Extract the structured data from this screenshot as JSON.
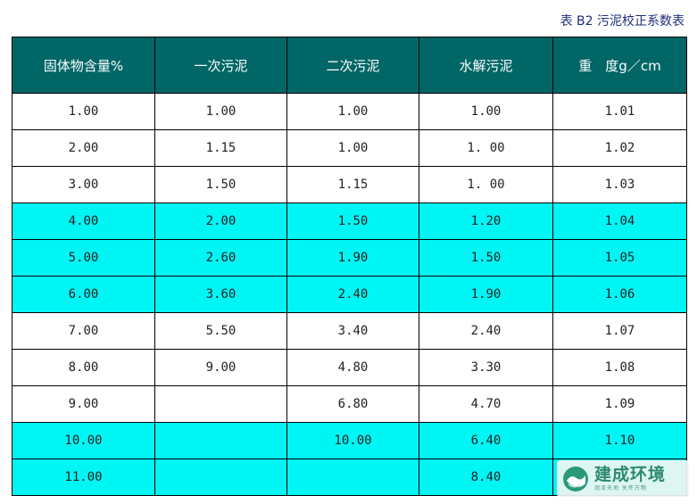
{
  "caption": "表 B2 污泥校正系数表",
  "headers": [
    "固体物含量%",
    "一次污泥",
    "二次污泥",
    "水解污泥",
    "重　度g／cm"
  ],
  "rows": [
    {
      "cells": [
        "1.00",
        "1.00",
        "1.00",
        "1.00",
        "1.01"
      ],
      "highlight": false
    },
    {
      "cells": [
        "2.00",
        "1.15",
        "1.00",
        "1. 00",
        "1.02"
      ],
      "highlight": false
    },
    {
      "cells": [
        "3.00",
        "1.50",
        "1.15",
        "1. 00",
        "1.03"
      ],
      "highlight": false
    },
    {
      "cells": [
        "4.00",
        "2.00",
        "1.50",
        "1.20",
        "1.04"
      ],
      "highlight": true
    },
    {
      "cells": [
        "5.00",
        "2.60",
        "1.90",
        "1.50",
        "1.05"
      ],
      "highlight": true
    },
    {
      "cells": [
        "6.00",
        "3.60",
        "2.40",
        "1.90",
        "1.06"
      ],
      "highlight": true
    },
    {
      "cells": [
        "7.00",
        "5.50",
        "3.40",
        "2.40",
        "1.07"
      ],
      "highlight": false
    },
    {
      "cells": [
        "8.00",
        "9.00",
        "4.80",
        "3.30",
        "1.08"
      ],
      "highlight": false
    },
    {
      "cells": [
        "9.00",
        "",
        "6.80",
        "4.70",
        "1.09"
      ],
      "highlight": false
    },
    {
      "cells": [
        "10.00",
        "",
        "10.00",
        "6.40",
        "1.10"
      ],
      "highlight": true
    },
    {
      "cells": [
        "11.00",
        "",
        "",
        "8.40",
        ""
      ],
      "highlight": true
    }
  ],
  "watermark": {
    "name": "建成环境",
    "slogan": "润泽天地 关怀万物"
  },
  "colors": {
    "header_bg": "#006666",
    "header_text": "#ffffff",
    "highlight_row": "#00f5f5",
    "caption_text": "#1f2e7a"
  }
}
